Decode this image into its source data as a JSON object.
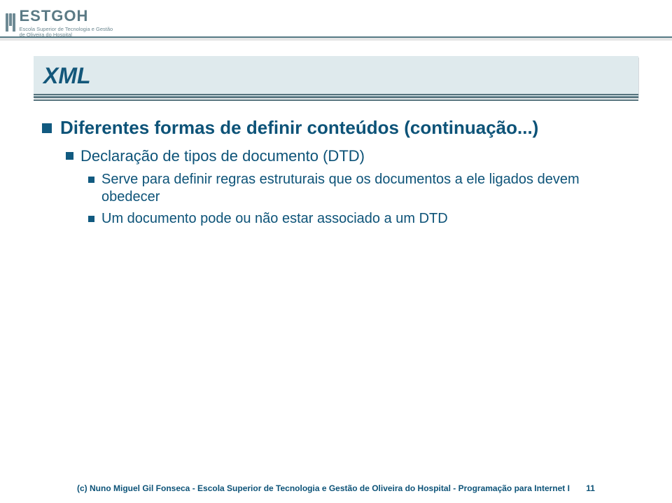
{
  "header": {
    "logo_text": "ESTGOH",
    "logo_sub_line1": "Escola Superior de Tecnologia e Gestão",
    "logo_sub_line2": "de Oliveira do Hospital"
  },
  "title": "XML",
  "bullets": {
    "level1_a": "Diferentes formas de definir conteúdos (continuação...)",
    "level2_a": "Declaração de tipos de documento (DTD)",
    "level3_a": "Serve para definir regras estruturais que os documentos a ele ligados devem obedecer",
    "level3_b": "Um documento pode ou não estar associado a um DTD"
  },
  "footer": {
    "text": "(c) Nuno Miguel Gil Fonseca  -  Escola Superior de Tecnologia e Gestão de Oliveira do Hospital  -  Programação para Internet I",
    "page": "11"
  },
  "colors": {
    "accent": "#0d5378",
    "title_bg": "#dfeaed"
  }
}
